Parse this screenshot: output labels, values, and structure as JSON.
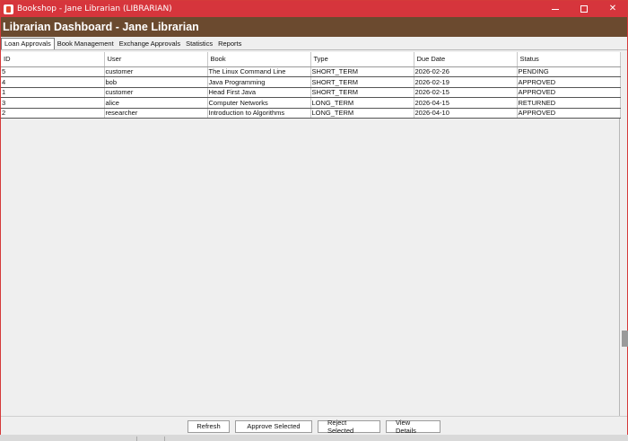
{
  "window": {
    "title": "Bookshop - Jane Librarian (LIBRARIAN)"
  },
  "header": {
    "title": "Librarian Dashboard - Jane Librarian"
  },
  "tabs": [
    {
      "label": "Loan Approvals",
      "active": true
    },
    {
      "label": "Book Management",
      "active": false
    },
    {
      "label": "Exchange Approvals",
      "active": false
    },
    {
      "label": "Statistics",
      "active": false
    },
    {
      "label": "Reports",
      "active": false
    }
  ],
  "table": {
    "columns": [
      "ID",
      "User",
      "Book",
      "Type",
      "Due Date",
      "Status"
    ],
    "rows": [
      [
        "5",
        "customer",
        "The Linux Command Line",
        "SHORT_TERM",
        "2026-02-26",
        "PENDING"
      ],
      [
        "4",
        "bob",
        "Java Programming",
        "SHORT_TERM",
        "2026-02-19",
        "APPROVED"
      ],
      [
        "1",
        "customer",
        "Head First Java",
        "SHORT_TERM",
        "2026-02-15",
        "APPROVED"
      ],
      [
        "3",
        "alice",
        "Computer Networks",
        "LONG_TERM",
        "2026-04-15",
        "RETURNED"
      ],
      [
        "2",
        "researcher",
        "Introduction to Algorithms",
        "LONG_TERM",
        "2026-04-10",
        "APPROVED"
      ]
    ]
  },
  "actions": {
    "refresh": "Refresh",
    "approve": "Approve Selected",
    "reject": "Reject Selected",
    "details": "View Details"
  },
  "colors": {
    "titlebar": "#d6353c",
    "header": "#6b4a2f"
  }
}
